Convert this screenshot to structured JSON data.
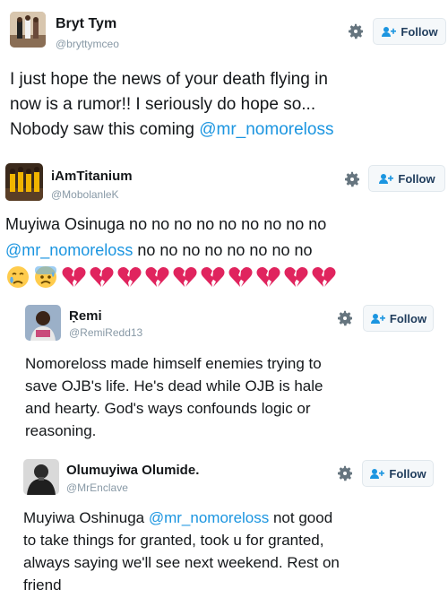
{
  "follow_label": "Follow",
  "tweets": [
    {
      "name": "Bryt Tym",
      "handle": "@bryttymceo",
      "lines": [
        "I just hope the news of your death flying in",
        "now is a rumor!! I seriously do hope so...",
        "Nobody saw this coming "
      ],
      "mention": "@mr_nomoreloss"
    },
    {
      "name": "iAmTitanium",
      "handle": "@MobolanleK",
      "line1": "Muyiwa Osinuga no no no no no no no no no",
      "mention": "@mr_nomoreloss",
      "line2_rest": " no no no no no no no no",
      "emojis": [
        "crying-sad-face",
        "anxious-sweat-face",
        "broken-heart",
        "broken-heart",
        "broken-heart",
        "broken-heart",
        "broken-heart",
        "broken-heart",
        "broken-heart",
        "broken-heart",
        "broken-heart",
        "broken-heart"
      ]
    },
    {
      "name": "Ṛemi",
      "handle": "@RemiRedd13",
      "lines": [
        "Nomoreloss made himself enemies trying to",
        "save OJB's life. He's dead while OJB is hale",
        "and hearty. God's ways confounds logic or",
        "reasoning."
      ]
    },
    {
      "name": "Olumuyiwa Olumide.",
      "handle": "@MrEnclave",
      "line1_pre": "Muyiwa Oshinuga ",
      "mention": "@mr_nomoreloss",
      "line1_post": " not good",
      "lines_rest": [
        "to take things for granted, took u for granted,",
        "always saying we'll see next weekend. Rest on",
        "friend"
      ]
    }
  ],
  "colors": {
    "mention": "#1b95e0",
    "broken_heart": "#e0245e",
    "follow_text": "#1f3c5c"
  }
}
